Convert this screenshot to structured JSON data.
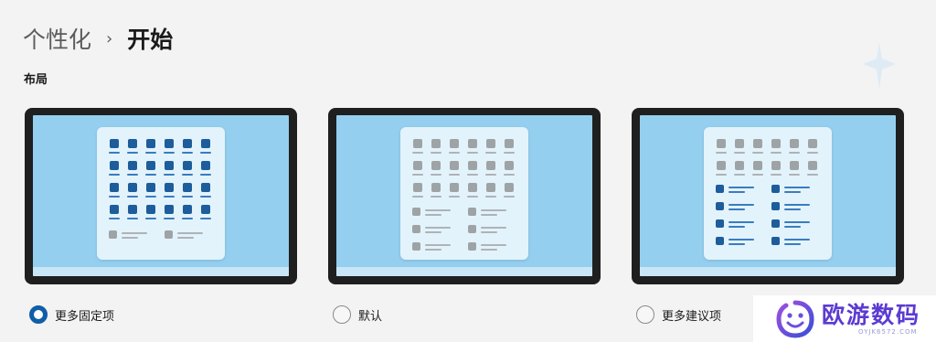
{
  "breadcrumb": {
    "parent": "个性化",
    "separator": "›",
    "current": "开始"
  },
  "section": {
    "title": "布局"
  },
  "layout_options": [
    {
      "label": "更多固定项",
      "selected": true,
      "pinned_rows_shown": 4,
      "recommended_rows_shown": 1
    },
    {
      "label": "默认",
      "selected": false,
      "pinned_rows_shown": 3,
      "recommended_rows_shown": 3
    },
    {
      "label": "更多建议项",
      "selected": false,
      "pinned_rows_shown": 2,
      "recommended_rows_shown": 4
    }
  ],
  "watermark": {
    "text": "欧游数码",
    "subtext": "OYJK6572.COM"
  },
  "colors": {
    "accent": "#0f5ea8",
    "screen": "#94cfef",
    "start_menu": "#e3f3fb",
    "icon_blue": "#1d5d9b",
    "icon_gray": "#9ea3a6",
    "watermark": "#5b3bd1"
  },
  "icons": {
    "chevron": "chevron-right-icon",
    "watermark_logo": "smiley-logo-icon"
  }
}
